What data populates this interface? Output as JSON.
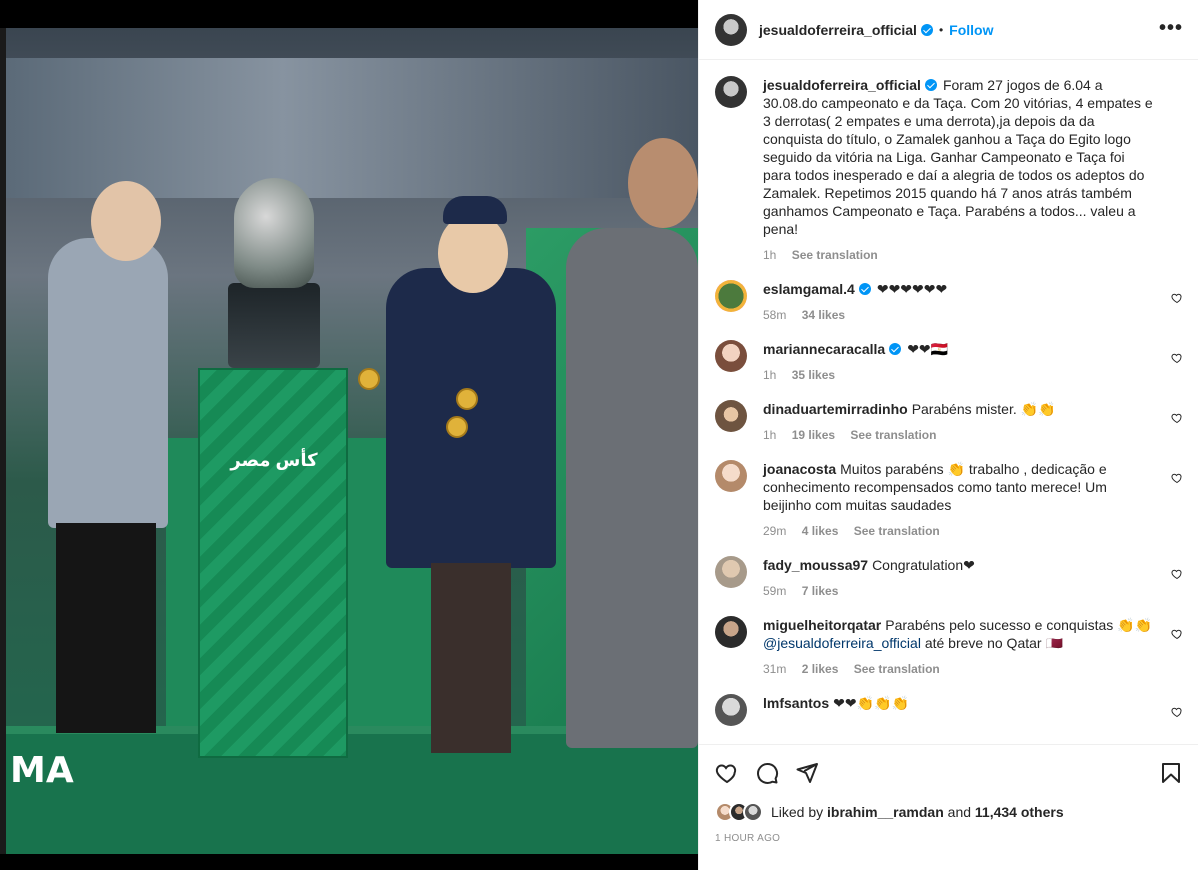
{
  "post": {
    "username": "jesualdoferreira_official",
    "follow_label": "Follow",
    "dot": "•",
    "more_label": "•••",
    "caption": "Foram 27 jogos de 6.04 a 30.08.do campeonato e da Taça. Com 20 vitórias, 4 empates e 3 derrotas( 2 empates e uma derrota),ja depois da da conquista do título, o Zamalek ganhou a Taça do Egito logo seguido da vitória na Liga. Ganhar Campeonato e Taça foi para todos inesperado e daí a alegria de todos os adeptos do Zamalek. Repetimos 2015 quando há 7 anos atrás também ganhamos Campeonato e Taça. Parabéns a todos... valeu a pena!",
    "caption_time": "1h",
    "see_translation": "See translation",
    "media_logo": "MA",
    "pedestal_text": "كأس مصر"
  },
  "comments": [
    {
      "username": "eslamgamal.4",
      "verified": true,
      "text": "❤❤❤❤❤❤",
      "time": "58m",
      "likes": "34 likes",
      "translate": ""
    },
    {
      "username": "mariannecaracalla",
      "verified": true,
      "text": "❤❤🇪🇬",
      "time": "1h",
      "likes": "35 likes",
      "translate": ""
    },
    {
      "username": "dinaduartemirradinho",
      "verified": false,
      "text": "Parabéns mister. 👏👏",
      "time": "1h",
      "likes": "19 likes",
      "translate": "See translation"
    },
    {
      "username": "joanacosta",
      "verified": false,
      "text": "Muitos parabéns 👏 trabalho , dedicação e conhecimento recompensados como tanto merece! Um beijinho com muitas saudades",
      "time": "29m",
      "likes": "4 likes",
      "translate": "See translation"
    },
    {
      "username": "fady_moussa97",
      "verified": false,
      "text": "Congratulation❤",
      "time": "59m",
      "likes": "7 likes",
      "translate": ""
    },
    {
      "username": "miguelheitorqatar",
      "verified": false,
      "text": "Parabéns pelo sucesso e conquistas 👏👏",
      "mention": "@jesualdoferreira_official",
      "text2": " até breve no Qatar 🇶🇦",
      "time": "31m",
      "likes": "2 likes",
      "translate": "See translation"
    },
    {
      "username": "lmfsantos",
      "verified": false,
      "text": "❤❤👏👏👏",
      "time": "",
      "likes": "",
      "translate": ""
    }
  ],
  "footer": {
    "liked_by_prefix": "Liked by",
    "liked_by_user": "ibrahim__ramdan",
    "and": "and",
    "others": "11,434 others",
    "timestamp": "1 HOUR AGO"
  },
  "icons": {
    "like": "heart-icon",
    "comment": "comment-icon",
    "share": "share-icon",
    "save": "bookmark-icon"
  }
}
